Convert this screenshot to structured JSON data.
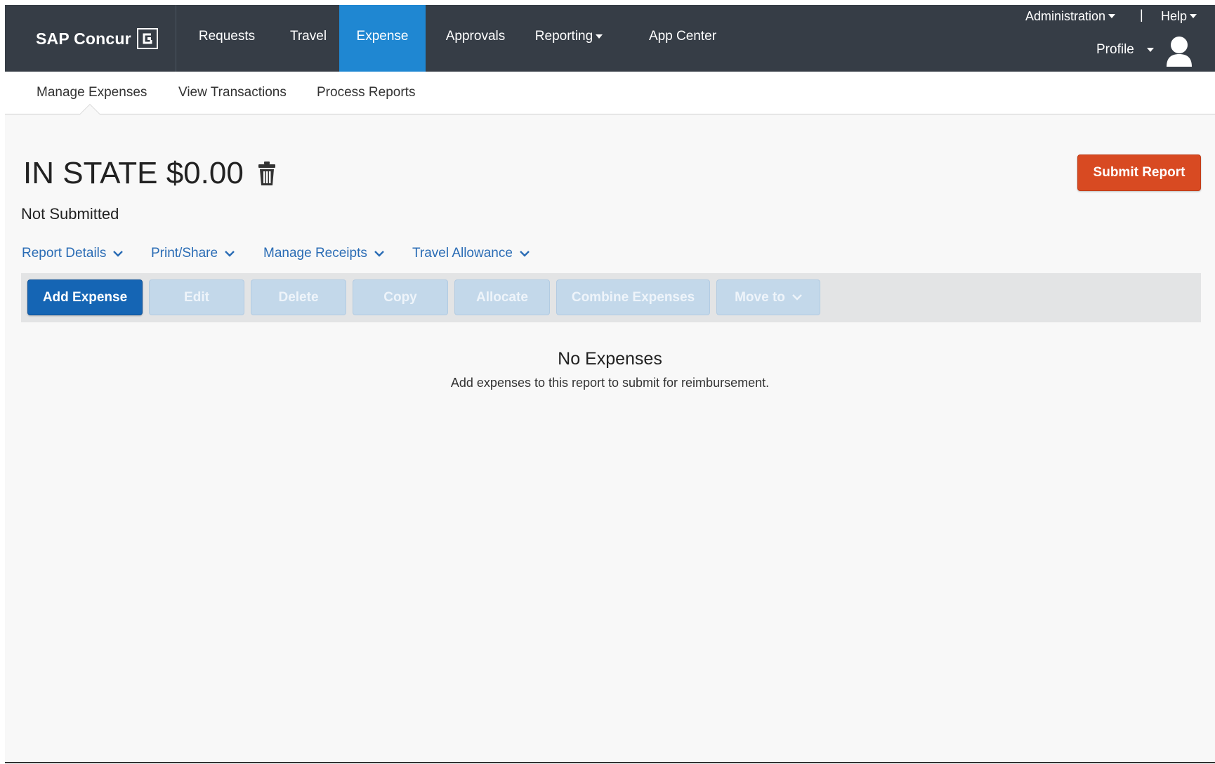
{
  "brand": {
    "name": "SAP Concur"
  },
  "topnav": {
    "items": [
      {
        "label": "Requests"
      },
      {
        "label": "Travel"
      },
      {
        "label": "Expense"
      },
      {
        "label": "Approvals"
      },
      {
        "label": "Reporting"
      },
      {
        "label": "App Center"
      }
    ],
    "active": "Expense",
    "administration": "Administration",
    "separator": "|",
    "help": "Help",
    "profile": "Profile"
  },
  "subnav": {
    "items": [
      {
        "label": "Manage Expenses"
      },
      {
        "label": "View Transactions"
      },
      {
        "label": "Process Reports"
      }
    ],
    "active": "Manage Expenses"
  },
  "report": {
    "title": "IN STATE $0.00",
    "status": "Not Submitted",
    "submit_label": "Submit Report"
  },
  "actions": [
    {
      "label": "Report Details"
    },
    {
      "label": "Print/Share"
    },
    {
      "label": "Manage Receipts"
    },
    {
      "label": "Travel Allowance"
    }
  ],
  "toolbar": {
    "add": "Add Expense",
    "edit": "Edit",
    "delete": "Delete",
    "copy": "Copy",
    "allocate": "Allocate",
    "combine": "Combine Expenses",
    "move_to": "Move to"
  },
  "empty": {
    "title": "No Expenses",
    "subtitle": "Add expenses to this report to submit for reimbursement."
  },
  "colors": {
    "topbar": "#363d46",
    "active_tab": "#1f87d2",
    "submit": "#d84a22",
    "primary": "#1565b4",
    "link": "#2a6cb5"
  },
  "icons": {
    "logo": "concur-c-logo-icon",
    "trash": "trash-icon",
    "avatar": "user-avatar-icon",
    "dropdown": "chevron-down-icon"
  }
}
